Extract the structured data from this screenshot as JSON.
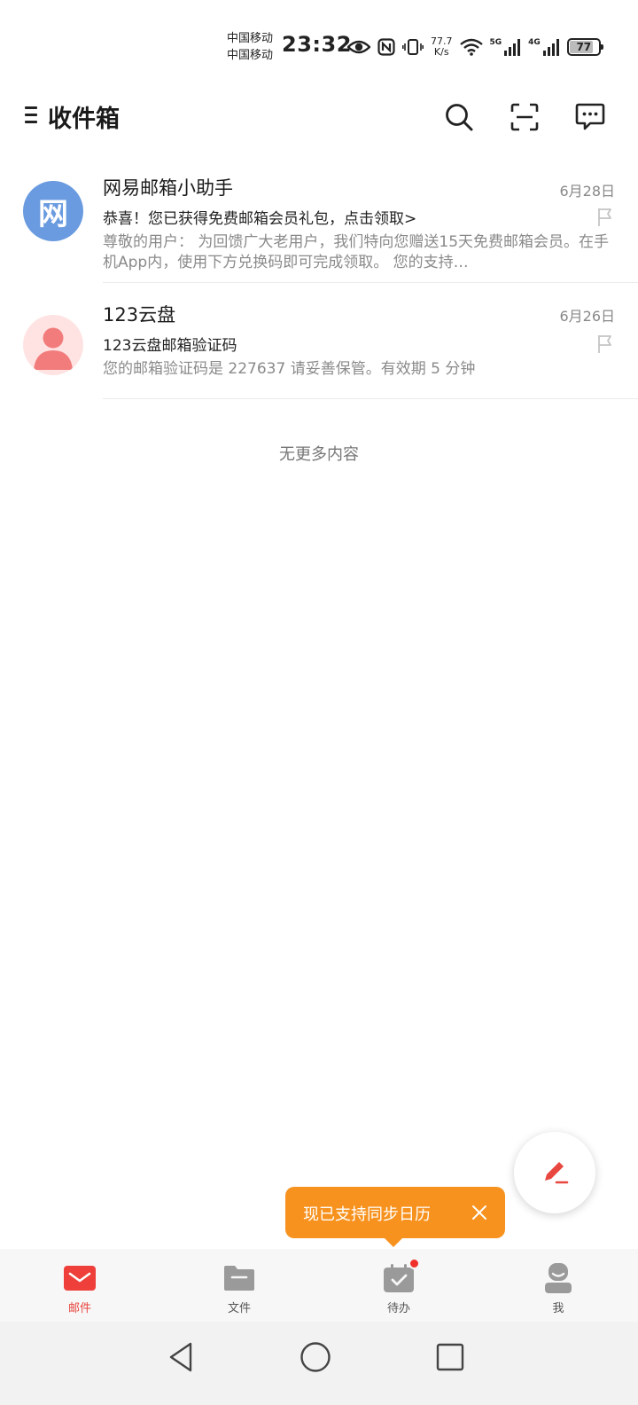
{
  "status_bar": {
    "carrier_1": "中国移动",
    "carrier_2": "中国移动",
    "time": "23:32",
    "speed_value": "77.7",
    "speed_unit": "K/s",
    "network_1": "5G",
    "network_2": "4G",
    "battery": "77",
    "battery_level": 0.77,
    "icons": [
      "eye-icon",
      "nfc-icon",
      "vibrate-icon",
      "wifi-icon",
      "signal-icon",
      "signal-icon",
      "battery-icon"
    ]
  },
  "header": {
    "title": "收件箱",
    "icons": [
      "menu-icon",
      "search-icon",
      "scan-icon",
      "message-icon"
    ]
  },
  "mails": [
    {
      "sender": "网易邮箱小助手",
      "avatar_text": "网",
      "avatar_color": "#6a9be0",
      "date": "6月28日",
      "subject": "恭喜！您已获得免费邮箱会员礼包，点击领取>",
      "preview": "尊敬的用户：  为回馈广大老用户，我们特向您赠送15天免费邮箱会员。在手机App内，使用下方兑换码即可完成领取。 您的支持…"
    },
    {
      "sender": "123云盘",
      "avatar_text": "",
      "avatar_color": "#ffe3e3",
      "date": "6月26日",
      "subject": "123云盘邮箱验证码",
      "preview": "您的邮箱验证码是 227637 请妥善保管。有效期 5 分钟"
    }
  ],
  "list_footer": "无更多内容",
  "toast": {
    "text": "现已支持同步日历"
  },
  "tabs": [
    {
      "label": "邮件",
      "icon": "mail-icon",
      "active": true
    },
    {
      "label": "文件",
      "icon": "folder-icon",
      "active": false
    },
    {
      "label": "待办",
      "icon": "todo-icon",
      "active": false,
      "badge": true
    },
    {
      "label": "我",
      "icon": "profile-icon",
      "active": false
    }
  ],
  "colors": {
    "accent": "#e8473f",
    "toast_bg": "#f7921e",
    "badge": "#f0302a"
  }
}
